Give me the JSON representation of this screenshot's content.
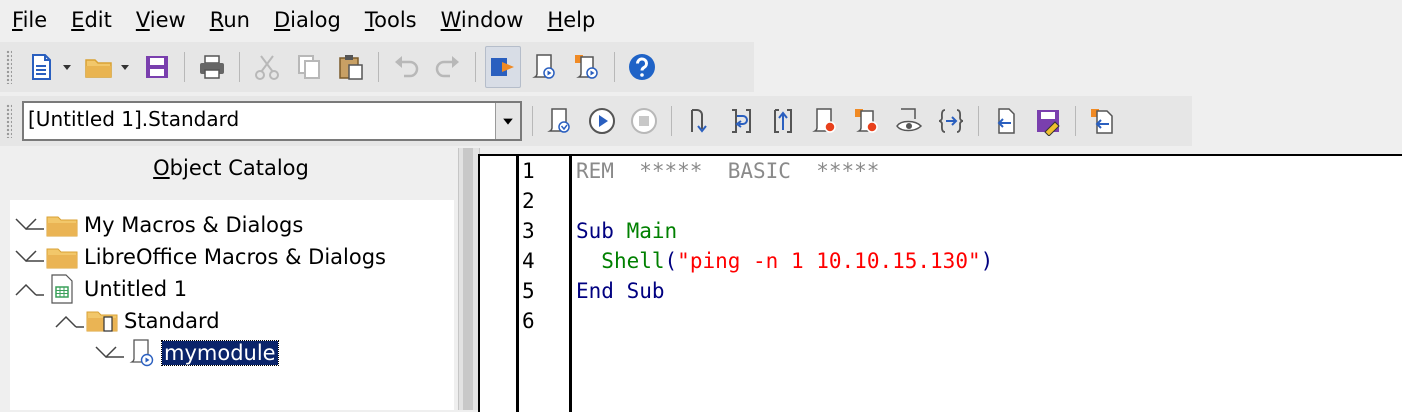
{
  "menubar": {
    "items": [
      {
        "label": "File",
        "accel": "F",
        "rest": "ile"
      },
      {
        "label": "Edit",
        "accel": "E",
        "rest": "dit"
      },
      {
        "label": "View",
        "accel": "V",
        "rest": "iew"
      },
      {
        "label": "Run",
        "accel": "R",
        "rest": "un"
      },
      {
        "label": "Dialog",
        "accel": "D",
        "rest": "ialog"
      },
      {
        "label": "Tools",
        "accel": "T",
        "rest": "ools"
      },
      {
        "label": "Window",
        "accel": "W",
        "rest": "indow"
      },
      {
        "label": "Help",
        "accel": "H",
        "rest": "elp"
      }
    ]
  },
  "toolbar2": {
    "library_selector": "[Untitled 1].Standard"
  },
  "catalog": {
    "title_accel": "O",
    "title_rest": "bject Catalog",
    "nodes": [
      {
        "label": "My Macros & Dialogs"
      },
      {
        "label": "LibreOffice Macros & Dialogs"
      },
      {
        "label": "Untitled 1"
      },
      {
        "label": "Standard"
      },
      {
        "label": "mymodule"
      }
    ]
  },
  "editor": {
    "line_numbers": [
      "1",
      "2",
      "3",
      "4",
      "5",
      "6"
    ],
    "lines": [
      {
        "tokens": [
          {
            "t": "REM  *****  BASIC  *****",
            "c": "comment"
          }
        ]
      },
      {
        "tokens": []
      },
      {
        "tokens": [
          {
            "t": "Sub ",
            "c": "kw"
          },
          {
            "t": "Main",
            "c": "id"
          }
        ]
      },
      {
        "tokens": [
          {
            "t": "  ",
            "c": "id"
          },
          {
            "t": "Shell",
            "c": "id"
          },
          {
            "t": "(",
            "c": "op"
          },
          {
            "t": "\"ping -n 1 10.10.15.130\"",
            "c": "str"
          },
          {
            "t": ")",
            "c": "op"
          }
        ]
      },
      {
        "tokens": [
          {
            "t": "End Sub",
            "c": "kw"
          }
        ]
      },
      {
        "tokens": []
      }
    ]
  },
  "colors": {
    "keyword": "#000080",
    "identifier": "#008000",
    "string": "#ff0000",
    "comment": "#8a8a8a",
    "selection": "#0a246a",
    "accent_blue": "#2a5fbf",
    "folder": "#e9b450",
    "save_purple": "#7a3fae",
    "help_blue": "#1f63c7",
    "record_red": "#e8401c"
  }
}
